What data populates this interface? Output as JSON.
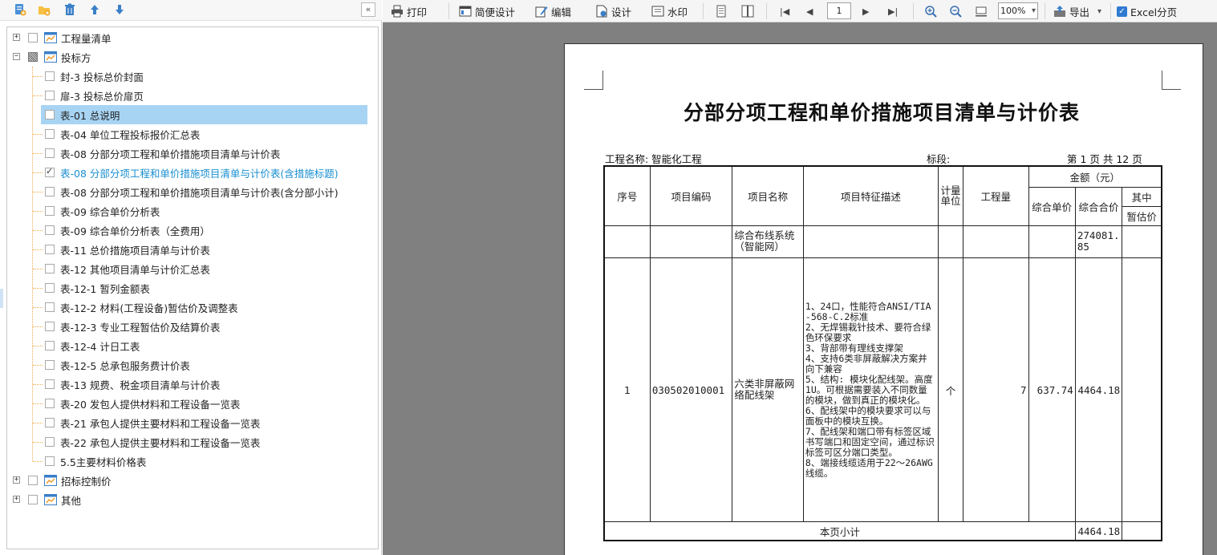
{
  "tree": {
    "groups": [
      {
        "label": "工程量清单",
        "state": "collapsed",
        "checked": "none"
      },
      {
        "label": "投标方",
        "state": "expanded",
        "checked": "partial"
      },
      {
        "label": "招标控制价",
        "state": "collapsed",
        "checked": "none"
      },
      {
        "label": "其他",
        "state": "collapsed",
        "checked": "none"
      }
    ],
    "items": [
      {
        "label": "封-3 投标总价封面",
        "checked": false
      },
      {
        "label": "扉-3 投标总价扉页",
        "checked": false
      },
      {
        "label": "表-01 总说明",
        "checked": false,
        "selected": true
      },
      {
        "label": "表-04 单位工程投标报价汇总表",
        "checked": false
      },
      {
        "label": "表-08 分部分项工程和单价措施项目清单与计价表",
        "checked": false
      },
      {
        "label": "表-08 分部分项工程和单价措施项目清单与计价表(含措施标题)",
        "checked": true
      },
      {
        "label": "表-08 分部分项工程和单价措施项目清单与计价表(含分部小计)",
        "checked": false
      },
      {
        "label": "表-09 综合单价分析表",
        "checked": false
      },
      {
        "label": "表-09 综合单价分析表（全费用）",
        "checked": false
      },
      {
        "label": "表-11 总价措施项目清单与计价表",
        "checked": false
      },
      {
        "label": "表-12 其他项目清单与计价汇总表",
        "checked": false
      },
      {
        "label": "表-12-1 暂列金额表",
        "checked": false
      },
      {
        "label": "表-12-2 材料(工程设备)暂估价及调整表",
        "checked": false
      },
      {
        "label": "表-12-3 专业工程暂估价及结算价表",
        "checked": false
      },
      {
        "label": "表-12-4 计日工表",
        "checked": false
      },
      {
        "label": "表-12-5 总承包服务费计价表",
        "checked": false
      },
      {
        "label": "表-13 规费、税金项目清单与计价表",
        "checked": false
      },
      {
        "label": "表-20 发包人提供材料和工程设备一览表",
        "checked": false
      },
      {
        "label": "表-21 承包人提供主要材料和工程设备一览表",
        "checked": false
      },
      {
        "label": "表-22 承包人提供主要材料和工程设备一览表",
        "checked": false
      },
      {
        "label": "5.5主要材料价格表",
        "checked": false
      }
    ]
  },
  "toolbar": {
    "print": "打印",
    "simple_design": "简便设计",
    "edit": "编辑",
    "design": "设计",
    "watermark": "水印",
    "page_number": "1",
    "zoom": "100%",
    "export": "导出",
    "excel_split": "Excel分页",
    "excel_split_checked": true
  },
  "report": {
    "title": "分部分项工程和单价措施项目清单与计价表",
    "project_label": "工程名称: 智能化工程",
    "section_label": "标段:",
    "page_label": "第 1 页  共 12 页",
    "headers": {
      "seq": "序号",
      "code": "项目编码",
      "name": "项目名称",
      "desc": "项目特征描述",
      "unit": "计量单位",
      "qty": "工程量",
      "amount": "金额（元）",
      "unit_price": "综合单价",
      "total": "综合合价",
      "of_which": "其中",
      "provisional": "暂估价"
    },
    "section_row": {
      "name": "综合布线系统（智能网）",
      "total": "274081.85"
    },
    "item_row": {
      "seq": "1",
      "code": "030502010001",
      "name": "六类非屏蔽网络配线架",
      "desc": "1、24口，性能符合ANSI/TIA-568-C.2标准\n2、无焊锡栽针技术、要符合绿色环保要求\n3、背部带有理线支撑架\n4、支持6类非屏蔽解决方案并向下兼容\n5、结构: 模块化配线架。高度1U。可根据需要装入不同数量的模块，做到真正的模块化。\n6、配线架中的模块要求可以与面板中的模块互换。\n7、配线架和端口带有标签区域书写端口和固定空间，通过标识标签可区分端口类型。\n8、端接线缆适用于22～26AWG线缆。",
      "unit": "个",
      "qty": "7",
      "unit_price": "637.74",
      "total": "4464.18"
    },
    "subtotal": {
      "label": "本页小计",
      "total": "4464.18"
    }
  }
}
